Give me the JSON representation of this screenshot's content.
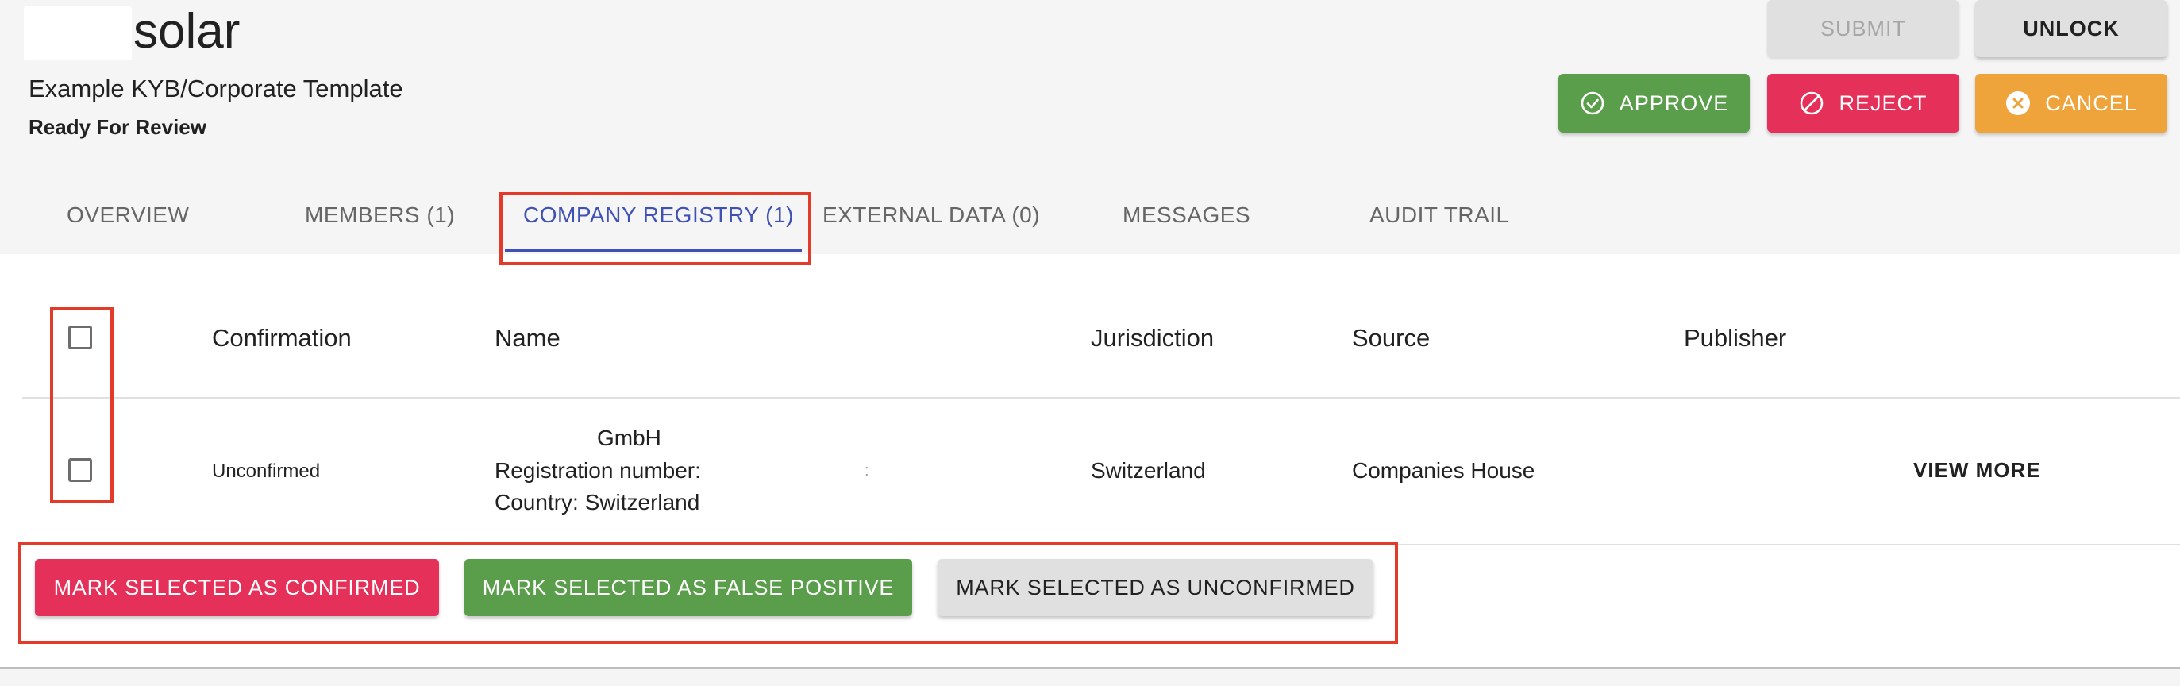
{
  "header": {
    "brand": "solar",
    "template_name": "Example KYB/Corporate Template",
    "status": "Ready For Review"
  },
  "actions": {
    "submit": "SUBMIT",
    "unlock": "UNLOCK",
    "approve": "APPROVE",
    "reject": "REJECT",
    "cancel": "CANCEL"
  },
  "tabs": [
    {
      "label": "OVERVIEW"
    },
    {
      "label": "MEMBERS (1)"
    },
    {
      "label": "COMPANY REGISTRY (1)",
      "active": true
    },
    {
      "label": "EXTERNAL DATA (0)"
    },
    {
      "label": "MESSAGES"
    },
    {
      "label": "AUDIT TRAIL"
    }
  ],
  "table": {
    "columns": [
      "Confirmation",
      "Name",
      "Jurisdiction",
      "Source",
      "Publisher"
    ],
    "rows": [
      {
        "confirmation": "Unconfirmed",
        "name_line1": "GmbH",
        "name_line2": "Registration number:",
        "name_line3": "Country: Switzerland",
        "separator": ":",
        "jurisdiction": "Switzerland",
        "source": "Companies House",
        "publisher": "",
        "view_more": "VIEW MORE"
      }
    ]
  },
  "bulk_actions": {
    "confirm": "MARK SELECTED AS CONFIRMED",
    "false_positive": "MARK SELECTED AS FALSE POSITIVE",
    "unconfirm": "MARK SELECTED AS UNCONFIRMED"
  },
  "colors": {
    "accent": "#3f51b5",
    "approve": "#5a9e4b",
    "reject": "#e53159",
    "cancel": "#eea43a",
    "annotation": "#e23b2a"
  }
}
